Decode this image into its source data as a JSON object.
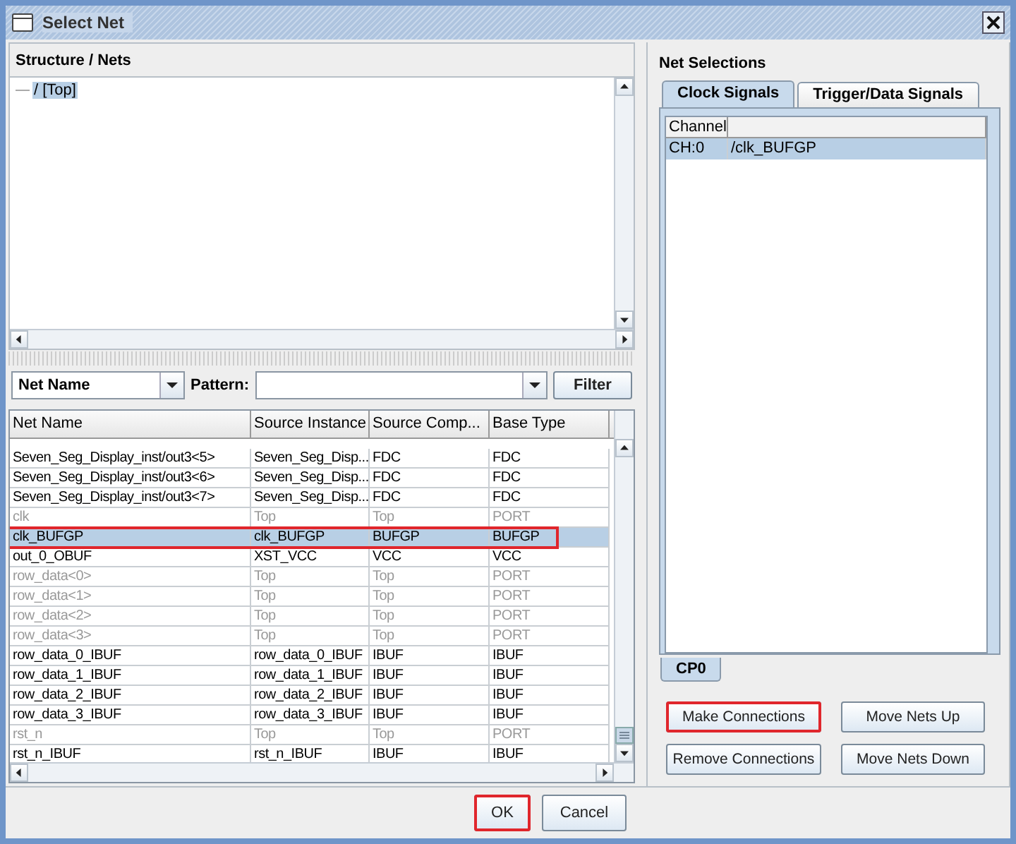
{
  "window": {
    "title": "Select Net"
  },
  "structure": {
    "title": "Structure / Nets",
    "tree": [
      {
        "label": "/ [Top]",
        "selected": true
      }
    ]
  },
  "filter": {
    "field": "Net Name",
    "pattern_label": "Pattern:",
    "button": "Filter"
  },
  "net_table": {
    "columns": [
      "Net Name",
      "Source Instance",
      "Source Comp...",
      "Base Type"
    ],
    "rows": [
      {
        "cells": [
          "Seven_Seg_Display_inst/out3<5>",
          "Seven_Seg_Disp...",
          "FDC",
          "FDC"
        ],
        "dimmed": false,
        "selected": false,
        "highlighted": false
      },
      {
        "cells": [
          "Seven_Seg_Display_inst/out3<6>",
          "Seven_Seg_Disp...",
          "FDC",
          "FDC"
        ],
        "dimmed": false,
        "selected": false,
        "highlighted": false
      },
      {
        "cells": [
          "Seven_Seg_Display_inst/out3<7>",
          "Seven_Seg_Disp...",
          "FDC",
          "FDC"
        ],
        "dimmed": false,
        "selected": false,
        "highlighted": false
      },
      {
        "cells": [
          "clk",
          "Top",
          "Top",
          "PORT"
        ],
        "dimmed": true,
        "selected": false,
        "highlighted": false
      },
      {
        "cells": [
          "clk_BUFGP",
          "clk_BUFGP",
          "BUFGP",
          "BUFGP"
        ],
        "dimmed": false,
        "selected": true,
        "highlighted": true
      },
      {
        "cells": [
          "out_0_OBUF",
          "XST_VCC",
          "VCC",
          "VCC"
        ],
        "dimmed": false,
        "selected": false,
        "highlighted": false
      },
      {
        "cells": [
          "row_data<0>",
          "Top",
          "Top",
          "PORT"
        ],
        "dimmed": true,
        "selected": false,
        "highlighted": false
      },
      {
        "cells": [
          "row_data<1>",
          "Top",
          "Top",
          "PORT"
        ],
        "dimmed": true,
        "selected": false,
        "highlighted": false
      },
      {
        "cells": [
          "row_data<2>",
          "Top",
          "Top",
          "PORT"
        ],
        "dimmed": true,
        "selected": false,
        "highlighted": false
      },
      {
        "cells": [
          "row_data<3>",
          "Top",
          "Top",
          "PORT"
        ],
        "dimmed": true,
        "selected": false,
        "highlighted": false
      },
      {
        "cells": [
          "row_data_0_IBUF",
          "row_data_0_IBUF",
          "IBUF",
          "IBUF"
        ],
        "dimmed": false,
        "selected": false,
        "highlighted": false
      },
      {
        "cells": [
          "row_data_1_IBUF",
          "row_data_1_IBUF",
          "IBUF",
          "IBUF"
        ],
        "dimmed": false,
        "selected": false,
        "highlighted": false
      },
      {
        "cells": [
          "row_data_2_IBUF",
          "row_data_2_IBUF",
          "IBUF",
          "IBUF"
        ],
        "dimmed": false,
        "selected": false,
        "highlighted": false
      },
      {
        "cells": [
          "row_data_3_IBUF",
          "row_data_3_IBUF",
          "IBUF",
          "IBUF"
        ],
        "dimmed": false,
        "selected": false,
        "highlighted": false
      },
      {
        "cells": [
          "rst_n",
          "Top",
          "Top",
          "PORT"
        ],
        "dimmed": true,
        "selected": false,
        "highlighted": false
      },
      {
        "cells": [
          "rst_n_IBUF",
          "rst_n_IBUF",
          "IBUF",
          "IBUF"
        ],
        "dimmed": false,
        "selected": false,
        "highlighted": false
      }
    ]
  },
  "net_selections": {
    "title": "Net Selections",
    "tabs": [
      {
        "label": "Clock Signals",
        "selected": true
      },
      {
        "label": "Trigger/Data Signals",
        "selected": false
      }
    ],
    "columns": [
      "Channel"
    ],
    "rows": [
      {
        "cells": [
          "CH:0",
          "/clk_BUFGP"
        ],
        "selected": true
      }
    ],
    "bottom_tabs": [
      {
        "label": "CP0",
        "selected": true
      }
    ]
  },
  "action_buttons": [
    {
      "label": "Make Connections",
      "highlighted": true
    },
    {
      "label": "Move Nets Up",
      "highlighted": false
    },
    {
      "label": "Remove Connections",
      "highlighted": false
    },
    {
      "label": "Move Nets Down",
      "highlighted": false
    }
  ],
  "dialog_buttons": [
    {
      "label": "OK",
      "highlighted": true
    },
    {
      "label": "Cancel",
      "highlighted": false
    }
  ]
}
